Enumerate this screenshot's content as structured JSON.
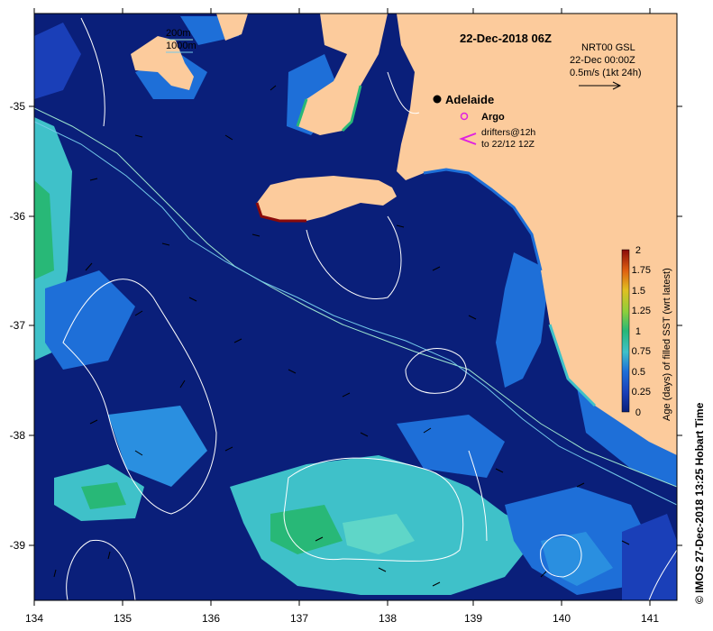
{
  "title": "22-Dec-2018 06Z",
  "depth_legend": {
    "line1": "200m",
    "line2": "1000m"
  },
  "current_key": {
    "line1": "NRT00 GSL",
    "line2": "22-Dec 00:00Z",
    "line3": "0.5m/s (1kt 24h)"
  },
  "city": "Adelaide",
  "argo_label": "Argo",
  "drifters": {
    "line1": "drifters@12h",
    "line2": "to 22/12 12Z"
  },
  "colorbar": {
    "title": "Age (days) of filled SST (wrt latest)",
    "ticks": [
      "2",
      "1.75",
      "1.5",
      "1.25",
      "1",
      "0.75",
      "0.5",
      "0.25",
      "0"
    ]
  },
  "credit": "© IMOS 27-Dec-2018 13:25 Hobart Time",
  "axes": {
    "x_ticks": [
      "134",
      "135",
      "136",
      "137",
      "138",
      "139",
      "140",
      "141"
    ],
    "y_ticks": [
      "-35",
      "-36",
      "-37",
      "-38",
      "-39"
    ]
  },
  "colors": {
    "ocean": "#0a1f7a",
    "land": "#fccb9c",
    "age_low": "#1e6fd8",
    "age_mid": "#3fc1c9",
    "age_green": "#28b877",
    "contour": "#ffffff",
    "isobath_200": "#9ee6d0",
    "isobath_1000": "#74c9e8",
    "argo": "#e020e0"
  }
}
